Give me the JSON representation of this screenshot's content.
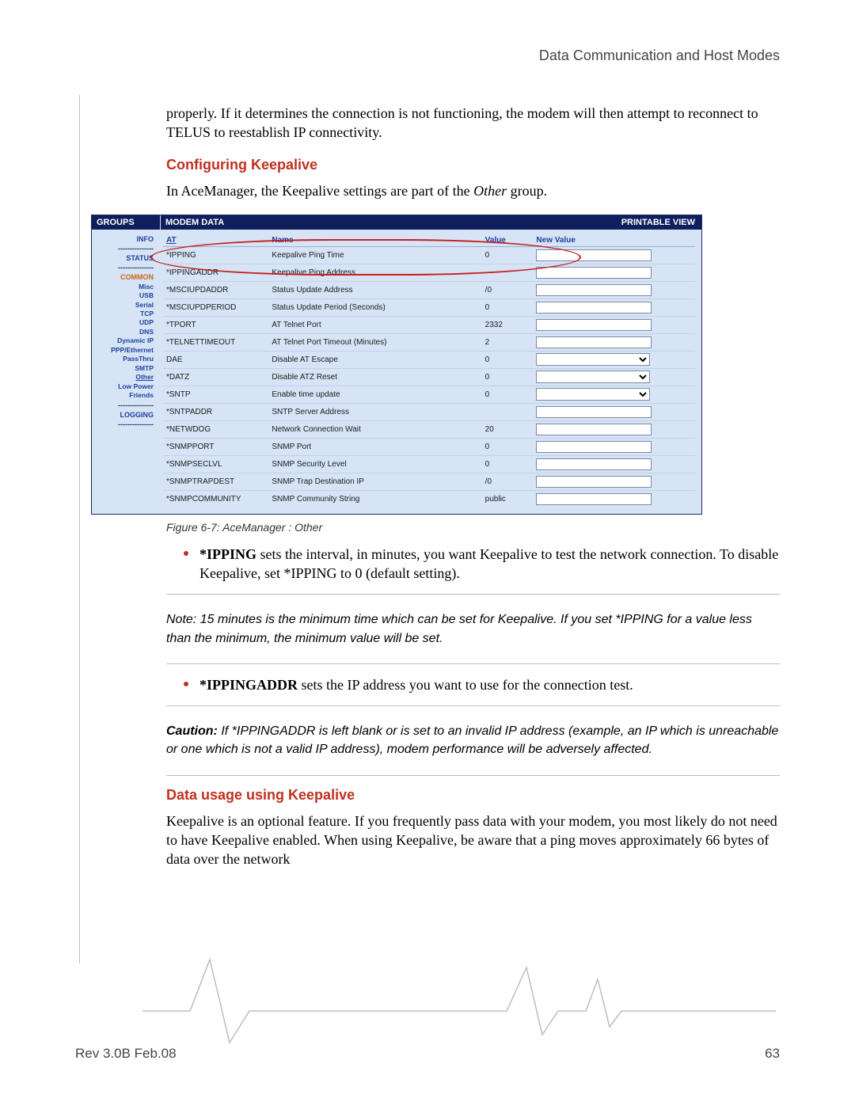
{
  "header": "Data Communication and Host Modes",
  "intro_para": "properly. If it determines the connection is not functioning, the modem will then attempt to reconnect to TELUS to reestablish IP connectivity.",
  "heading_conf": "Configuring Keepalive",
  "conf_para_a": "In AceManager, the Keepalive settings are part of the ",
  "conf_para_b": "Other",
  "conf_para_c": " group.",
  "ace": {
    "groups": "GROUPS",
    "modem_data": "MODEM DATA",
    "printable": "PRINTABLE VIEW",
    "side": {
      "info": "INFO",
      "status": "STATUS",
      "common": "COMMON",
      "misc": "Misc",
      "usb": "USB",
      "serial": "Serial",
      "tcp": "TCP",
      "udp": "UDP",
      "dns": "DNS",
      "dyn": "Dynamic IP",
      "ppp": "PPP/Ethernet",
      "pass": "PassThru",
      "smtp": "SMTP",
      "other": "Other",
      "lowpower": "Low Power",
      "friends": "Friends",
      "logging": "LOGGING",
      "sep": "---------------"
    },
    "cols": {
      "at": "AT",
      "name": "Name",
      "value": "Value",
      "newvalue": "New Value"
    },
    "rows": [
      {
        "at": "*IPPING",
        "name": "Keepalive Ping Time",
        "value": "0",
        "type": "text"
      },
      {
        "at": "*IPPINGADDR",
        "name": "Keepalive Ping Address",
        "value": "",
        "type": "text"
      },
      {
        "at": "*MSCIUPDADDR",
        "name": "Status Update Address",
        "value": "/0",
        "type": "text"
      },
      {
        "at": "*MSCIUPDPERIOD",
        "name": "Status Update Period (Seconds)",
        "value": "0",
        "type": "text"
      },
      {
        "at": "*TPORT",
        "name": "AT Telnet Port",
        "value": "2332",
        "type": "text"
      },
      {
        "at": "*TELNETTIMEOUT",
        "name": "AT Telnet Port Timeout (Minutes)",
        "value": "2",
        "type": "text"
      },
      {
        "at": "DAE",
        "name": "Disable AT Escape",
        "value": "0",
        "type": "select"
      },
      {
        "at": "*DATZ",
        "name": "Disable ATZ Reset",
        "value": "0",
        "type": "select"
      },
      {
        "at": "*SNTP",
        "name": "Enable time update",
        "value": "0",
        "type": "select"
      },
      {
        "at": "*SNTPADDR",
        "name": "SNTP Server Address",
        "value": "",
        "type": "text"
      },
      {
        "at": "*NETWDOG",
        "name": "Network Connection Wait",
        "value": "20",
        "type": "text"
      },
      {
        "at": "*SNMPPORT",
        "name": "SNMP Port",
        "value": "0",
        "type": "text"
      },
      {
        "at": "*SNMPSECLVL",
        "name": "SNMP Security Level",
        "value": "0",
        "type": "text"
      },
      {
        "at": "*SNMPTRAPDEST",
        "name": "SNMP Trap Destination IP",
        "value": "/0",
        "type": "text"
      },
      {
        "at": "*SNMPCOMMUNITY",
        "name": "SNMP Community String",
        "value": "public",
        "type": "text"
      }
    ]
  },
  "figure_caption": "Figure 6-7: AceManager : Other",
  "bullet1_strong": "*IPPING",
  "bullet1_rest": " sets the interval, in minutes, you want Keepalive to test the network connection. To disable Keepalive, set *IPPING to 0 (default setting).",
  "note1": "Note: 15 minutes is the minimum time which can be set for Keepalive. If you set *IPPING for a value less than the minimum, the minimum value will be set.",
  "bullet2_strong": "*IPPINGADDR",
  "bullet2_rest": " sets the IP address you want to use for the connection test.",
  "caution_label": "Caution:",
  "caution_rest": "  If *IPPINGADDR is left blank or is set to an invalid IP address (example, an IP which is unreachable or one which is not a valid IP address), modem performance will be adversely affected.",
  "heading_usage": "Data usage using Keepalive",
  "usage_para": "Keepalive is an optional feature. If you frequently pass data with your modem, you most likely do not need to have Keepalive enabled. When using Keepalive, be aware that a ping moves approximately 66 bytes of data over the network",
  "footer_left": "Rev 3.0B  Feb.08",
  "footer_right": "63"
}
